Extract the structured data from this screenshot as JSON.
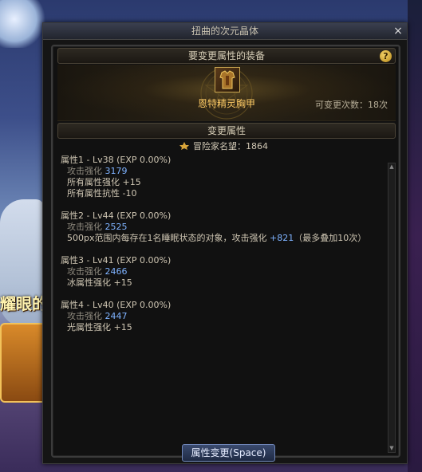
{
  "window": {
    "title": "扭曲的次元晶体",
    "close_glyph": "×"
  },
  "equip_section": {
    "header": "要变更属性的装备",
    "help_glyph": "?",
    "item_name": "恩特精灵胸甲",
    "change_count": "可变更次数：18次"
  },
  "attr_section": {
    "header": "变更属性",
    "fame": "冒险家名望：1864"
  },
  "attributes": [
    {
      "title": "属性1 - Lv38 (EXP 0.00%)",
      "lines": [
        {
          "label": "攻击强化",
          "value": "3179"
        },
        {
          "label": "所有属性强化",
          "value": "+15"
        },
        {
          "label": "所有属性抗性",
          "value": "-10"
        }
      ]
    },
    {
      "title": "属性2 - Lv44 (EXP 0.00%)",
      "lines": [
        {
          "label": "攻击强化",
          "value": "2525"
        },
        {
          "label": "500px范围内每存在1名睡眠状态的对象，攻击强化",
          "value": "+821",
          "suffix": "（最多叠加10次）"
        }
      ]
    },
    {
      "title": "属性3 - Lv41 (EXP 0.00%)",
      "lines": [
        {
          "label": "攻击强化",
          "value": "2466"
        },
        {
          "label": "冰属性强化",
          "value": "+15"
        }
      ]
    },
    {
      "title": "属性4 - Lv40 (EXP 0.00%)",
      "lines": [
        {
          "label": "攻击强化",
          "value": "2447"
        },
        {
          "label": "光属性强化",
          "value": "+15"
        }
      ]
    }
  ],
  "footer": {
    "apply_button": "属性变更(Space)"
  },
  "background": {
    "banner_text": "耀眼的"
  },
  "colors": {
    "accent_value": "#7fb3ff",
    "item_name": "#ffcc66",
    "button_border": "#6f86b8"
  }
}
